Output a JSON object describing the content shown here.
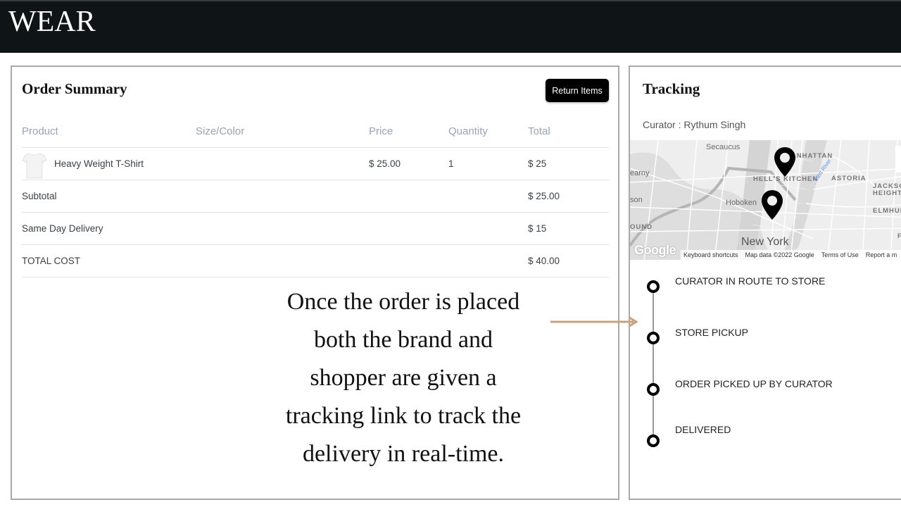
{
  "header": {
    "brand": "WEAR"
  },
  "order_summary": {
    "title": "Order Summary",
    "return_button": "Return Items",
    "columns": [
      "Product",
      "Size/Color",
      "Price",
      "Quantity",
      "Total"
    ],
    "items": [
      {
        "product": "Heavy Weight T-Shirt",
        "size_color": "",
        "price": "$ 25.00",
        "quantity": "1",
        "total": "$ 25",
        "image_icon": "tshirt-icon"
      }
    ],
    "summary_rows": [
      {
        "label": "Subtotal",
        "value": "$ 25.00"
      },
      {
        "label": "Same Day Delivery",
        "value": "$ 15"
      },
      {
        "label": "TOTAL COST",
        "value": "$ 40.00"
      }
    ]
  },
  "caption": {
    "lines": [
      "Once the order is placed",
      "both the brand and",
      "shopper are given a",
      "tracking link to track the",
      "delivery in real-time."
    ],
    "arrow_color": "#c9a27a"
  },
  "tracking": {
    "title": "Tracking",
    "curator": "Curator : Rythum Singh",
    "map": {
      "labels": {
        "secaucus": "Secaucus",
        "manhattan": "MANHATTAN",
        "kearny": "earny",
        "hells_kitchen": "HELL'S KITCHEN",
        "astoria": "ASTORIA",
        "east_river": "East River",
        "jackson_heights_1": "JACKSON",
        "jackson_heights_2": "HEIGHTS",
        "son": "son",
        "hoboken": "Hoboken",
        "elmhurst": "ELMHURST",
        "ound": "OUND",
        "fo": "FO",
        "new_york": "New York"
      },
      "google_logo": "Google",
      "footer": [
        "Keyboard shortcuts",
        "Map data ©2022 Google",
        "Terms of Use",
        "Report a m"
      ],
      "pins": 2
    },
    "steps": [
      {
        "label": "CURATOR IN ROUTE TO STORE"
      },
      {
        "label": "STORE PICKUP"
      },
      {
        "label": "ORDER PICKED UP BY CURATOR"
      },
      {
        "label": "DELIVERED"
      }
    ]
  }
}
